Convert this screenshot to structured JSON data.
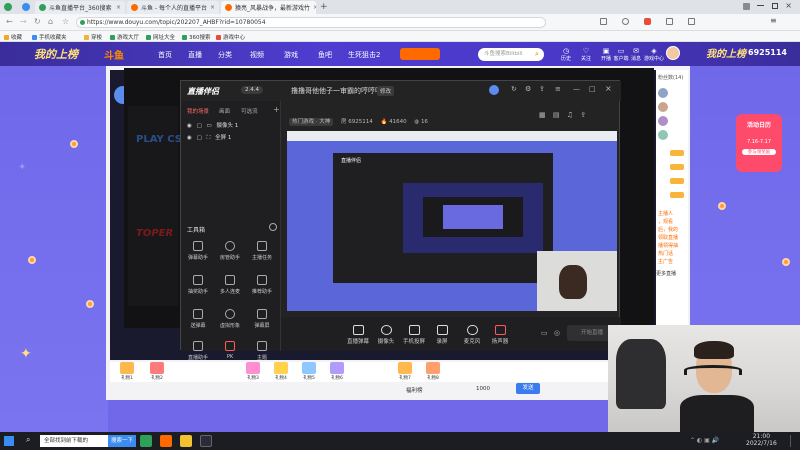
{
  "browser": {
    "tabs": [
      {
        "title": "斗鱼直播平台_360搜索",
        "color": "#2fa05a"
      },
      {
        "title": "斗鱼 - 每个人的直播平台",
        "color": "#ff6a00"
      },
      {
        "title": "猿亮_风暴战争，最新游戏竹",
        "color": "#ff6a00"
      }
    ],
    "new_tab": "+",
    "url": "https://www.douyu.com/topic/202207_AHBF?rid=10780054",
    "bookmarks": [
      "收藏",
      "手机收藏夹",
      "穿梭",
      "游戏大厅",
      "网址大全",
      "360搜索",
      "游戏中心"
    ]
  },
  "site": {
    "logo": "斗鱼",
    "nav": [
      "首页",
      "直播",
      "分类",
      "视频",
      "游戏",
      "鱼吧",
      "生死狙击2"
    ],
    "search_placeholder": "斗鱼搜索Bilibili",
    "user_actions": [
      "历史",
      "关注",
      "开播",
      "客户端",
      "消息",
      "游戏中心"
    ],
    "banner_text": "我的上榜",
    "banner_count": "6925114",
    "event_badge": {
      "title": "活动日历",
      "dates": "7.16-7.17",
      "sub": "参与领奖励"
    },
    "side_text": [
      "主播人",
      "，观看",
      "后，我的",
      "领取直播",
      "播领得抽",
      "热门话",
      "主广告"
    ],
    "side_right": "更多直播",
    "scroll_hint": "未开启直播",
    "gifts": [
      "礼物1",
      "礼物2",
      "礼物3",
      "礼物4",
      "礼物5",
      "礼物6",
      "礼物7",
      "礼物8"
    ],
    "chat_count": "粉丝数(14)",
    "bottom_bar": {
      "label": "福利榜",
      "points": "1000",
      "send": "发送"
    }
  },
  "obs": {
    "app_name": "直播伴侣",
    "version": "2.4.4",
    "tabs": [
      "我的场景",
      "画面",
      "可选流"
    ],
    "scenes": [
      {
        "label": "摄像头 1"
      },
      {
        "label": "全屏 1"
      }
    ],
    "toolbox_title": "工具箱",
    "tools": [
      [
        "弹幕助手",
        "房管助手",
        "主播任务"
      ],
      [
        "抽奖助手",
        "多人连麦",
        "推荐助手"
      ],
      [
        "送弹幕",
        "虚拟形象",
        "弹幕屏"
      ],
      [
        "直播助手",
        "PK",
        "主题"
      ]
    ],
    "stream_title": "撸撸哥他他子一审霸的哼哼哼",
    "edit_label": "修改",
    "category": "热门游戏 · 大神",
    "room": "6925114",
    "hot": "41640",
    "viewers": "16",
    "bottom": [
      "直播弹幕",
      "摄像头",
      "手机投屏",
      "录屏",
      "麦克风",
      "扬声器"
    ],
    "start_button": "开始直播"
  },
  "taskbar": {
    "search": "全部找到前下载的",
    "app_label": "搜索一下",
    "time": "21:00",
    "date": "2022/7/16"
  }
}
